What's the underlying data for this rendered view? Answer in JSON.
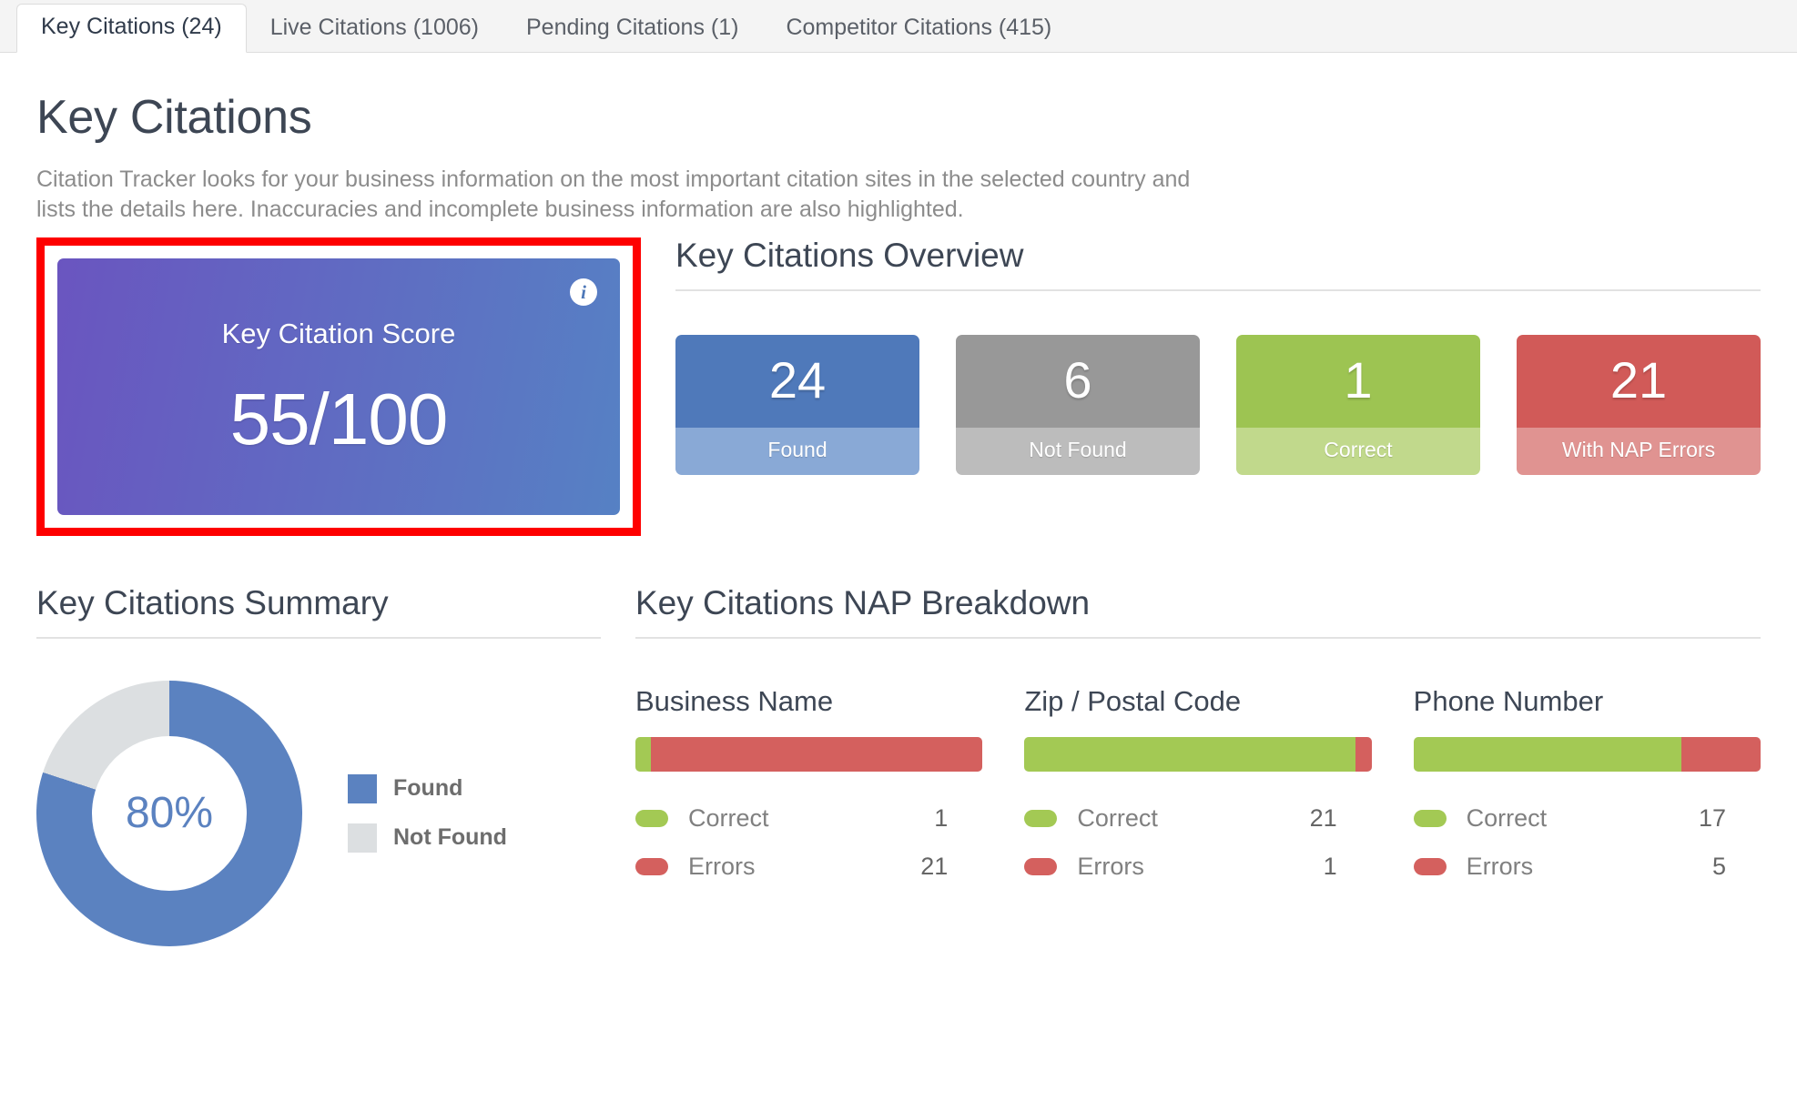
{
  "tabs": [
    {
      "label": "Key Citations (24)",
      "active": true
    },
    {
      "label": "Live Citations (1006)",
      "active": false
    },
    {
      "label": "Pending Citations (1)",
      "active": false
    },
    {
      "label": "Competitor Citations (415)",
      "active": false
    }
  ],
  "page": {
    "title": "Key Citations",
    "description": "Citation Tracker looks for your business information on the most important citation sites in the selected country and lists the details here. Inaccuracies and incomplete business information are also highlighted."
  },
  "score_card": {
    "label": "Key Citation Score",
    "value": "55/100",
    "info_icon": "info-icon",
    "gradient_start": "#6a55c0",
    "gradient_end": "#5681c4",
    "highlight_color": "#fe0000"
  },
  "overview": {
    "title": "Key Citations Overview",
    "cards": [
      {
        "value": "24",
        "label": "Found",
        "color": "#4f79ba",
        "color_light": "#89a9d6"
      },
      {
        "value": "6",
        "label": "Not Found",
        "color": "#989898",
        "color_light": "#bcbcbc"
      },
      {
        "value": "1",
        "label": "Correct",
        "color": "#9dc452",
        "color_light": "#c1d98c"
      },
      {
        "value": "21",
        "label": "With NAP Errors",
        "color": "#d15a58",
        "color_light": "#e09391"
      }
    ]
  },
  "summary": {
    "title": "Key Citations Summary",
    "center_label": "80%",
    "legend": [
      {
        "label": "Found",
        "color": "#5b82c0"
      },
      {
        "label": "Not Found",
        "color": "#dcdfe1"
      }
    ]
  },
  "nap": {
    "title": "Key Citations NAP Breakdown",
    "correct_label": "Correct",
    "errors_label": "Errors",
    "correct_color": "#a3c954",
    "errors_color": "#d4605e",
    "items": [
      {
        "title": "Business Name",
        "correct": 1,
        "errors": 21,
        "correct_str": "1",
        "errors_str": "21"
      },
      {
        "title": "Zip / Postal Code",
        "correct": 21,
        "errors": 1,
        "correct_str": "21",
        "errors_str": "1"
      },
      {
        "title": "Phone Number",
        "correct": 17,
        "errors": 5,
        "correct_str": "17",
        "errors_str": "5"
      }
    ]
  },
  "chart_data": [
    {
      "type": "pie",
      "title": "Key Citations Summary",
      "categories": [
        "Found",
        "Not Found"
      ],
      "values": [
        80,
        20
      ],
      "colors": [
        "#5b82c0",
        "#dcdfe1"
      ],
      "center_label": "80%",
      "legend_position": "right",
      "units": "percent",
      "donut": true
    },
    {
      "type": "bar",
      "title": "Business Name",
      "categories": [
        "Correct",
        "Errors"
      ],
      "values": [
        1,
        21
      ],
      "colors": [
        "#a3c954",
        "#d4605e"
      ],
      "orientation": "horizontal",
      "stacked": true
    },
    {
      "type": "bar",
      "title": "Zip / Postal Code",
      "categories": [
        "Correct",
        "Errors"
      ],
      "values": [
        21,
        1
      ],
      "colors": [
        "#a3c954",
        "#d4605e"
      ],
      "orientation": "horizontal",
      "stacked": true
    },
    {
      "type": "bar",
      "title": "Phone Number",
      "categories": [
        "Correct",
        "Errors"
      ],
      "values": [
        17,
        5
      ],
      "colors": [
        "#a3c954",
        "#d4605e"
      ],
      "orientation": "horizontal",
      "stacked": true
    },
    {
      "type": "table",
      "title": "Key Citations Overview",
      "categories": [
        "Found",
        "Not Found",
        "Correct",
        "With NAP Errors"
      ],
      "values": [
        24,
        6,
        1,
        21
      ]
    }
  ]
}
